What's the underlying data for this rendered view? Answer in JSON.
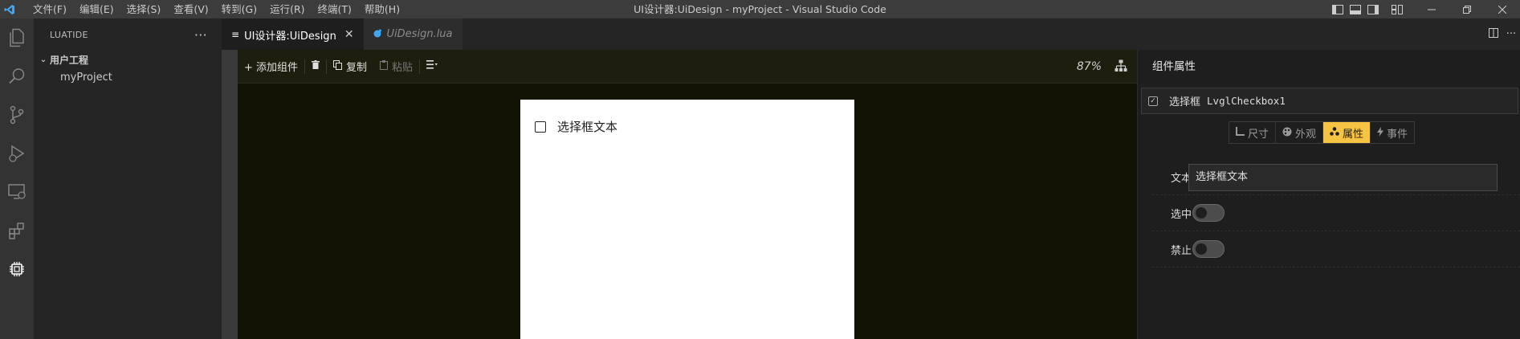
{
  "window": {
    "title": "UI设计器:UiDesign - myProject - Visual Studio Code",
    "menu": [
      "文件(F)",
      "编辑(E)",
      "选择(S)",
      "查看(V)",
      "转到(G)",
      "运行(R)",
      "终端(T)",
      "帮助(H)"
    ]
  },
  "activity": {
    "icons": [
      "explorer-icon",
      "search-icon",
      "source-control-icon",
      "run-debug-icon",
      "remote-explorer-icon",
      "extensions-icon",
      "luatide-chip-icon"
    ]
  },
  "sidebar": {
    "title": "LUATIDE",
    "more": "···",
    "root": "用户工程",
    "project": "myProject"
  },
  "tabs": [
    {
      "label": "UI设计器:UiDesign",
      "active": true
    },
    {
      "label": "UiDesign.lua",
      "active": false
    }
  ],
  "toolbar": {
    "add": "+ 添加组件",
    "copy": "复制",
    "paste": "粘贴",
    "zoom": "87%"
  },
  "canvas": {
    "checkbox_label": "选择框文本",
    "checked": false
  },
  "panel": {
    "title": "组件属性",
    "component_type": "选择框",
    "component_name": "LvglCheckbox1",
    "tabs": [
      {
        "label": "尺寸",
        "icon": "ruler-icon",
        "active": false
      },
      {
        "label": "外观",
        "icon": "palette-icon",
        "active": false
      },
      {
        "label": "属性",
        "icon": "props-icon",
        "active": true
      },
      {
        "label": "事件",
        "icon": "bolt-icon",
        "active": false
      }
    ],
    "props": {
      "text_label": "文本",
      "text_value": "选择框文本",
      "checked_label": "选中",
      "checked_value": false,
      "disabled_label": "禁止",
      "disabled_value": false
    }
  },
  "colors": {
    "accent": "#f6c343",
    "canvas_bg": "#131304",
    "vscode_blue": "#3ea6f3"
  }
}
